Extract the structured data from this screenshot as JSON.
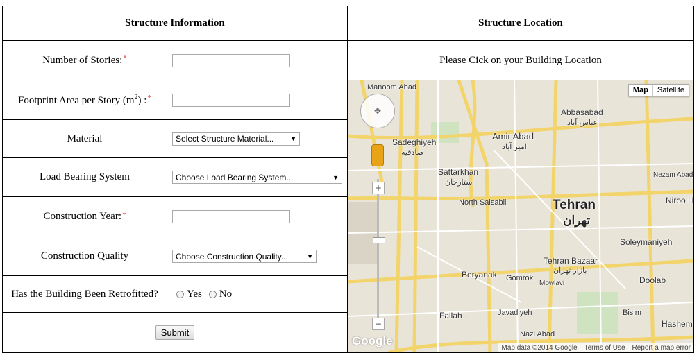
{
  "headers": {
    "info": "Structure Information",
    "location": "Structure Location"
  },
  "location_prompt": "Please Cick on your Building Location",
  "form": {
    "stories_label": "Number of Stories:",
    "footprint_label": "Footprint Area per Story (m",
    "footprint_sup": "2",
    "footprint_tail": ") :",
    "material_label": "Material",
    "material_select": "Select Structure Material...",
    "load_label": "Load Bearing System",
    "load_select": "Choose Load Bearing System...",
    "year_label": "Construction Year:",
    "quality_label": "Construction Quality",
    "quality_select": "Choose Construction Quality...",
    "retrofit_label": "Has the Building Been Retrofitted?",
    "yes": "Yes",
    "no": "No",
    "required_mark": "*",
    "submit": "Submit"
  },
  "map": {
    "type_map": "Map",
    "type_satellite": "Satellite",
    "labels": {
      "tehran": "Tehran",
      "tehran_fa": "تهران",
      "amir_abad": "Amir Abad",
      "amir_abad_fa": "امیر آباد",
      "abbasabad": "Abbasabad",
      "abbasabad_fa": "عباس آباد",
      "sadeghiyeh": "Sadeghiyeh",
      "sadeghiyeh_fa": "صادقیه",
      "sattarkhan": "Sattarkhan",
      "sattarkhan_fa": "ستارخان",
      "north_salsabil": "North Salsabil",
      "tehran_bazaar": "Tehran Bazaar",
      "tehran_bazaar_fa": "بازار تهران",
      "beryanak": "Beryanak",
      "gomrok": "Gomrok",
      "fallah": "Fallah",
      "javadiyeh": "Javadiyeh",
      "nazi_abad": "Nazi Abad",
      "soleymaniyeh": "Soleymaniyeh",
      "doolab": "Doolab",
      "nezam_abad": "Nezam Abad",
      "niroo": "Niroo H",
      "hashem": "Hashem",
      "bisim": "Bisim",
      "mowlavi": "Mowlavi",
      "manoom_abad": "Manoom Abad"
    },
    "logo": "Google",
    "map_data": "Map data ©2014 Google",
    "terms": "Terms of Use",
    "report": "Report a map error"
  }
}
